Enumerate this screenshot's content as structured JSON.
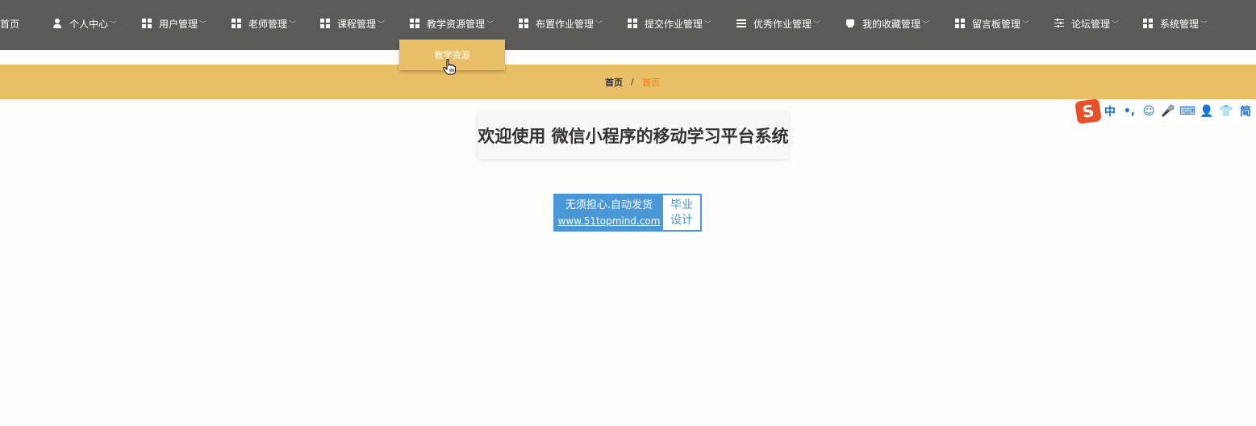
{
  "nav": {
    "items": [
      {
        "label": "首页",
        "icon": "none"
      },
      {
        "label": "个人中心",
        "icon": "user-icon"
      },
      {
        "label": "用户管理",
        "icon": "grid-icon"
      },
      {
        "label": "老师管理",
        "icon": "grid-icon"
      },
      {
        "label": "课程管理",
        "icon": "grid-icon"
      },
      {
        "label": "教学资源管理",
        "icon": "grid-icon"
      },
      {
        "label": "布置作业管理",
        "icon": "grid-icon"
      },
      {
        "label": "提交作业管理",
        "icon": "grid-icon"
      },
      {
        "label": "优秀作业管理",
        "icon": "list-icon"
      },
      {
        "label": "我的收藏管理",
        "icon": "favorite-icon"
      },
      {
        "label": "留言板管理",
        "icon": "grid-icon"
      },
      {
        "label": "论坛管理",
        "icon": "sliders-icon"
      },
      {
        "label": "系统管理",
        "icon": "grid-icon"
      }
    ],
    "dropdown": {
      "label": "教学资源"
    }
  },
  "breadcrumb": {
    "home": "首页",
    "separator": "/",
    "current": "首页"
  },
  "welcome": {
    "title": "欢迎使用 微信小程序的移动学习平台系统"
  },
  "badge": {
    "line1": "无须担心.自动发货",
    "line2": "www.51topmind.com",
    "right1": "毕业",
    "right2": "设计"
  },
  "ime": {
    "logo": "S",
    "buttons": [
      "中",
      "•,",
      "☺",
      "🎤",
      "⌨",
      "👤",
      "👕",
      "简"
    ]
  },
  "colors": {
    "nav_bg": "#5c5a56",
    "accent": "#e8bf67",
    "current_crumb": "#f07d1a",
    "badge_blue": "#4a97d8"
  }
}
